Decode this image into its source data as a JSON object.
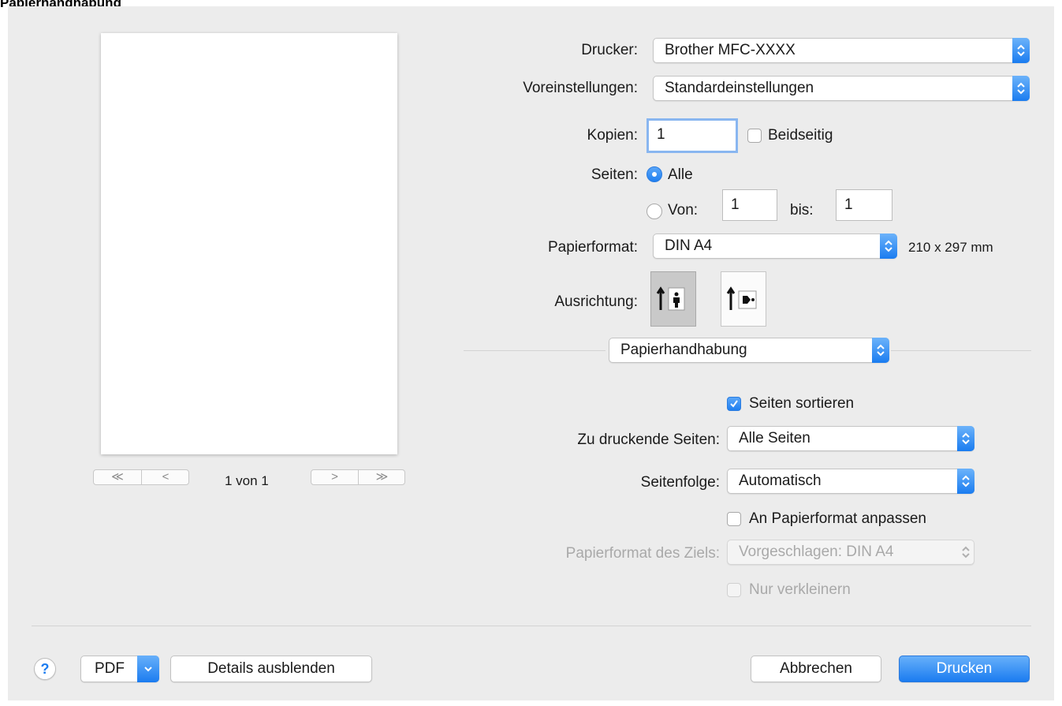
{
  "page_heading": "Papierhandhabung",
  "preview": {
    "page_indicator": "1 von 1",
    "nav_first": "≪",
    "nav_prev": "<",
    "nav_next": ">",
    "nav_last": "≫"
  },
  "printer": {
    "label": "Drucker:",
    "value": "Brother MFC-XXXX"
  },
  "presets": {
    "label": "Voreinstellungen:",
    "value": "Standardeinstellungen"
  },
  "copies": {
    "label": "Kopien:",
    "value": "1",
    "duplex_label": "Beidseitig",
    "duplex_checked": false
  },
  "pages": {
    "label": "Seiten:",
    "all_label": "Alle",
    "from_label": "Von:",
    "from_value": "1",
    "to_label": "bis:",
    "to_value": "1",
    "selected": "all"
  },
  "paper_size": {
    "label": "Papierformat:",
    "value": "DIN A4",
    "dimensions": "210 x 297 mm"
  },
  "orientation": {
    "label": "Ausrichtung:",
    "selected": "portrait",
    "icons": [
      "portrait-orientation-icon",
      "landscape-orientation-icon"
    ]
  },
  "section_popup": {
    "value": "Papierhandhabung"
  },
  "paper_handling": {
    "collate_label": "Seiten sortieren",
    "collate_checked": true,
    "pages_to_print_label": "Zu druckende Seiten:",
    "pages_to_print_value": "Alle Seiten",
    "page_order_label": "Seitenfolge:",
    "page_order_value": "Automatisch",
    "scale_to_fit_label": "An Papierformat anpassen",
    "scale_to_fit_checked": false,
    "destination_size_label": "Papierformat des Ziels:",
    "destination_size_value": "Vorgeschlagen: DIN A4",
    "scale_down_only_label": "Nur verkleinern",
    "scale_down_only_checked": false
  },
  "footer": {
    "help_label": "?",
    "pdf_label": "PDF",
    "hide_details_label": "Details ausblenden",
    "cancel_label": "Abbrechen",
    "print_label": "Drucken"
  },
  "colors": {
    "accent": "#1b7cf0",
    "background": "#ececec",
    "disabled_text": "#a9a9a9"
  }
}
